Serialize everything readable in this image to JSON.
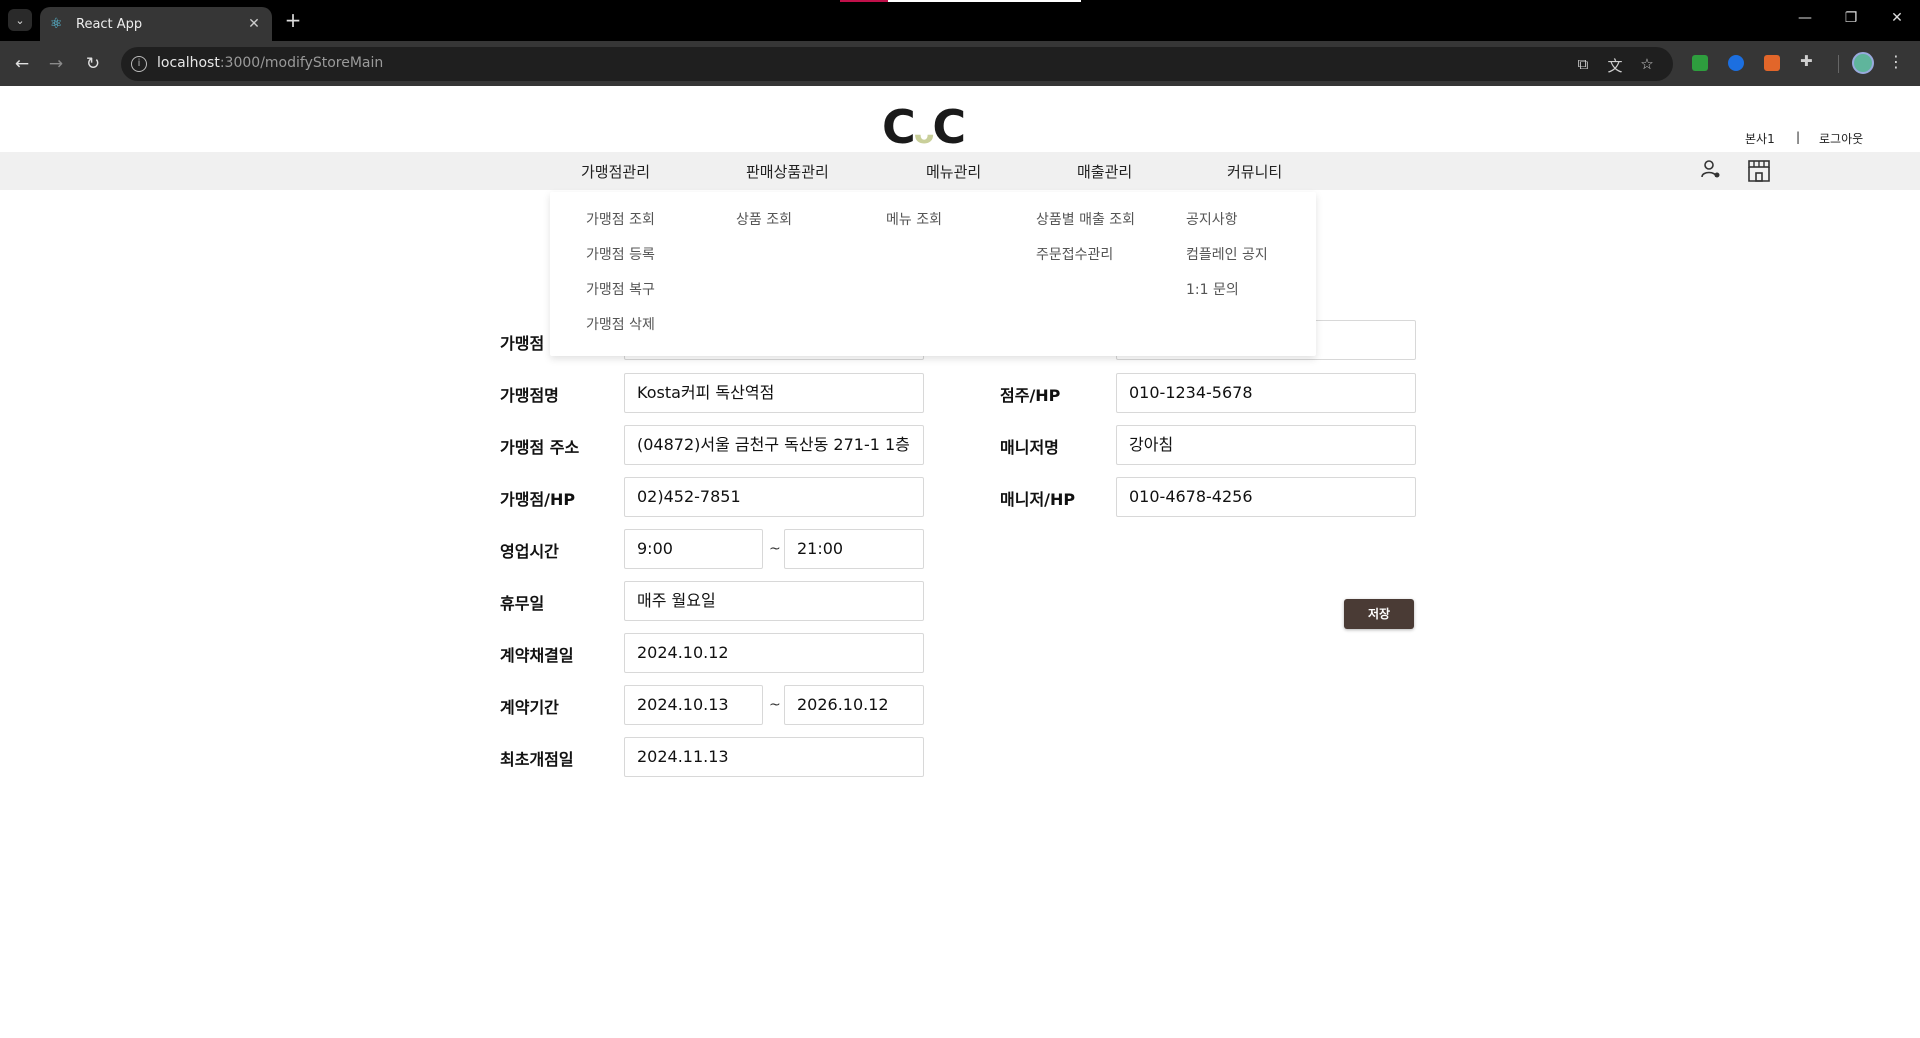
{
  "browser": {
    "tab_title": "React App",
    "url_host": "localhost",
    "url_path": ":3000/modifyStoreMain"
  },
  "header": {
    "logo_text_left": "C",
    "logo_text_mid": "ᴗ",
    "logo_text_right": "C",
    "user_name": "본사1",
    "separator": "|",
    "logout": "로그아웃"
  },
  "nav": {
    "items": [
      "가맹점관리",
      "판매상품관리",
      "메뉴관리",
      "매출관리",
      "커뮤니티"
    ]
  },
  "dropdown": {
    "col1": [
      "가맹점 조회",
      "가맹점 등록",
      "가맹점 복구",
      "가맹점 삭제"
    ],
    "col2": [
      "상품 조회"
    ],
    "col3": [
      "메뉴 조회"
    ],
    "col4": [
      "상품별 매출 조회",
      "주문접수관리"
    ],
    "col5": [
      "공지사항",
      "컴플레인 공지",
      "1:1 문의"
    ]
  },
  "form": {
    "store_code_label": "가맹점",
    "store_name_label": "가맹점명",
    "store_name_value": "Kosta커피 독산역점",
    "store_address_label": "가맹점 주소",
    "store_address_value": "(04872)서울 금천구 독산동 271-1 1층",
    "store_hp_label": "가맹점/HP",
    "store_hp_value": "02)452-7851",
    "hours_label": "영업시간",
    "hours_open": "9:00",
    "hours_close": "21:00",
    "tilde": "~",
    "holiday_label": "휴무일",
    "holiday_value": "매주 월요일",
    "contract_date_label": "계약채결일",
    "contract_date_value": "2024.10.12",
    "contract_period_label": "계약기간",
    "contract_start": "2024.10.13",
    "contract_end": "2026.10.12",
    "open_date_label": "최초개점일",
    "open_date_value": "2024.11.13",
    "owner_hp_label": "점주/HP",
    "owner_hp_value": "010-1234-5678",
    "manager_name_label": "매니저명",
    "manager_name_value": "강아침",
    "manager_hp_label": "매니저/HP",
    "manager_hp_value": "010-4678-4256",
    "save_label": "저장"
  }
}
